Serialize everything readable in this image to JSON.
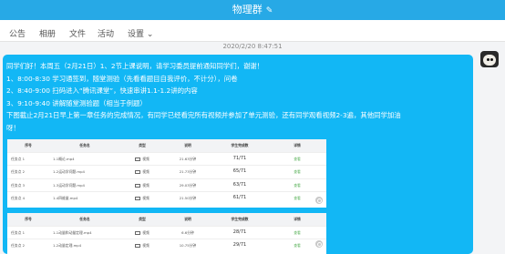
{
  "window": {
    "title": "物理群",
    "edit_icon": "pencil-icon"
  },
  "tabs": [
    "公告",
    "相册",
    "文件",
    "活动",
    "设置 ⌄"
  ],
  "timestamp": "2020/2/20 8:47:51",
  "message": {
    "lines": [
      "同学们好！本周五（2月21日）1、2节上课说明，请学习委员提前通知同学们，谢谢！",
      "1、8:00-8:30  学习通签到，随堂测验（先看看题目自我评价，不计分），问卷",
      "2、8:40-9:00  扫码进入“腾讯课堂”，快速串讲1.1-1.2讲的内容",
      "3、9:10-9:40  讲解随堂测验题（相当于例题）",
      "下图截止2月21日早上第一章任务的完成情况，有同学已经看完所有视频并参加了单元测验，还有同学观看视频2-3遍，其他同学加油",
      "呀！"
    ]
  },
  "table1": {
    "headers": [
      "序号",
      "任务名",
      "类型",
      "说明",
      "学生完成数",
      "详情"
    ],
    "rows": [
      [
        "任务点 1",
        "1-1概论.mp4",
        "视频",
        "21.63分钟",
        "71/71",
        "查看"
      ],
      [
        "任务点 2",
        "1-2运动学问题.mp4",
        "视频",
        "21.73分钟",
        "65/71",
        "查看"
      ],
      [
        "任务点 3",
        "1-3运动学问题.mp4",
        "视频",
        "29.03分钟",
        "63/71",
        "查看"
      ],
      [
        "任务点 4",
        "1-4四维量.mp4",
        "视频",
        "21.50分钟",
        "61/71",
        "查看"
      ]
    ]
  },
  "table2": {
    "headers": [
      "序号",
      "任务名",
      "类型",
      "说明",
      "学生完成数",
      "详情"
    ],
    "rows": [
      [
        "任务点 1",
        "1-1动量和动量定理.mp4",
        "视频",
        "6.6分钟",
        "28/71",
        "查看"
      ],
      [
        "任务点 2",
        "1-2动量定理.mp4",
        "视频",
        "10.75分钟",
        "29/71",
        "查看"
      ]
    ]
  }
}
